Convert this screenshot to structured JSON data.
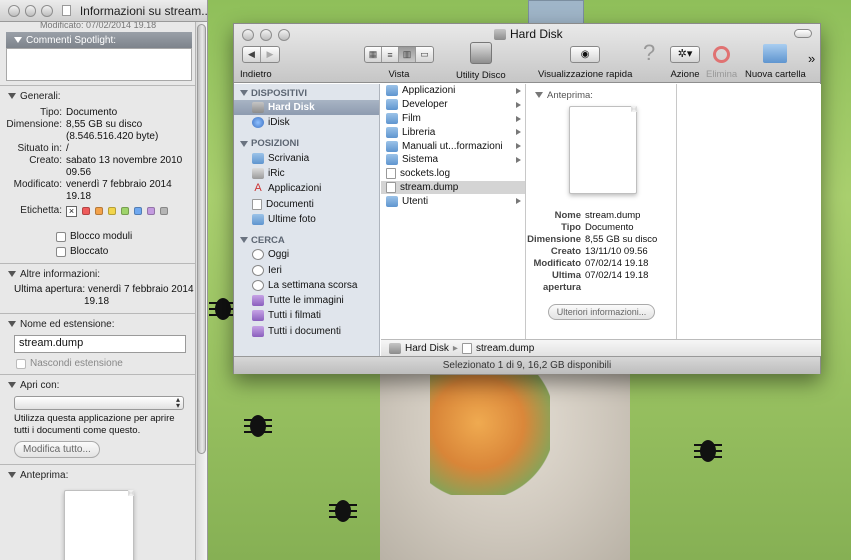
{
  "info_window": {
    "title": "Informazioni su stream...",
    "top_cut_text": "Modificato: 07/02/2014 19.18",
    "spotlight_header": "Commenti Spotlight:",
    "general": {
      "header": "Generali:",
      "rows": [
        {
          "k": "Tipo:",
          "v": "Documento"
        },
        {
          "k": "Dimensione:",
          "v": "8,55 GB su disco"
        },
        {
          "k": "",
          "v": "(8.546.516.420 byte)"
        },
        {
          "k": "Situato in:",
          "v": "/"
        },
        {
          "k": "Creato:",
          "v": "sabato 13 novembre 2010"
        },
        {
          "k": "",
          "v": "09.56"
        },
        {
          "k": "Modificato:",
          "v": "venerdì 7 febbraio 2014"
        },
        {
          "k": "",
          "v": "19.18"
        }
      ],
      "label_key": "Etichetta:",
      "label_colors": [
        "#ef5b5b",
        "#f3a24a",
        "#f2d54b",
        "#9fd46b",
        "#6fa8f0",
        "#c49be0",
        "#b5b5b5"
      ],
      "checkbox_lock_modules": "Blocco moduli",
      "checkbox_locked": "Bloccato"
    },
    "more_info": {
      "header": "Altre informazioni:",
      "last_open_label": "Ultima apertura:",
      "last_open_value": "venerdì 7 febbraio 2014",
      "last_open_time": "19.18"
    },
    "name_ext": {
      "header": "Nome ed estensione:",
      "filename": "stream.dump",
      "hide_ext": "Nascondi estensione"
    },
    "open_with": {
      "header": "Apri con:",
      "note": "Utilizza questa applicazione per aprire tutti i documenti come questo.",
      "button": "Modifica tutto..."
    },
    "preview": {
      "header": "Anteprima:"
    }
  },
  "finder": {
    "title": "Hard Disk",
    "toolbar": {
      "back_label": "Indietro",
      "view_label": "Vista",
      "disk_util_label": "Utility Disco",
      "quicklook_label": "Visualizzazione rapida",
      "action_label": "Azione",
      "delete_label": "Elimina",
      "new_folder_label": "Nuova cartella",
      "more": "»"
    },
    "sidebar": {
      "devices_header": "DISPOSITIVI",
      "devices": [
        {
          "label": "Hard Disk",
          "icon": "disk"
        },
        {
          "label": "iDisk",
          "icon": "globe"
        }
      ],
      "places_header": "POSIZIONI",
      "places": [
        {
          "label": "Scrivania",
          "icon": "folder"
        },
        {
          "label": "iRic",
          "icon": "home"
        },
        {
          "label": "Applicazioni",
          "icon": "apps"
        },
        {
          "label": "Documenti",
          "icon": "doc"
        },
        {
          "label": "Ultime foto",
          "icon": "folder"
        }
      ],
      "search_header": "CERCA",
      "searches": [
        {
          "label": "Oggi",
          "icon": "clock"
        },
        {
          "label": "Ieri",
          "icon": "clock"
        },
        {
          "label": "La settimana scorsa",
          "icon": "clock"
        },
        {
          "label": "Tutte le immagini",
          "icon": "purple"
        },
        {
          "label": "Tutti i filmati",
          "icon": "purple"
        },
        {
          "label": "Tutti i documenti",
          "icon": "purple"
        }
      ]
    },
    "files": [
      {
        "label": "Applicazioni",
        "kind": "folder",
        "arrow": true
      },
      {
        "label": "Developer",
        "kind": "folder",
        "arrow": true
      },
      {
        "label": "Film",
        "kind": "folder",
        "arrow": true
      },
      {
        "label": "Libreria",
        "kind": "folder",
        "arrow": true
      },
      {
        "label": "Manuali ut...formazioni",
        "kind": "folder",
        "arrow": true
      },
      {
        "label": "Sistema",
        "kind": "folder",
        "arrow": true
      },
      {
        "label": "sockets.log",
        "kind": "doc",
        "arrow": false
      },
      {
        "label": "stream.dump",
        "kind": "doc",
        "arrow": false,
        "selected": true
      },
      {
        "label": "Utenti",
        "kind": "folder",
        "arrow": true
      }
    ],
    "preview": {
      "header": "Anteprima:",
      "rows": [
        {
          "k": "Nome",
          "v": "stream.dump"
        },
        {
          "k": "Tipo",
          "v": "Documento"
        },
        {
          "k": "Dimensione",
          "v": "8,55 GB su disco"
        },
        {
          "k": "Creato",
          "v": "13/11/10 09.56"
        },
        {
          "k": "Modificato",
          "v": "07/02/14 19.18"
        },
        {
          "k": "Ultima apertura",
          "v": "07/02/14 19.18"
        }
      ],
      "more_button": "Ulteriori informazioni..."
    },
    "path": {
      "disk": "Hard Disk",
      "file": "stream.dump",
      "sep": "▸"
    },
    "status": "Selezionato 1 di 9, 16,2 GB disponibili"
  }
}
